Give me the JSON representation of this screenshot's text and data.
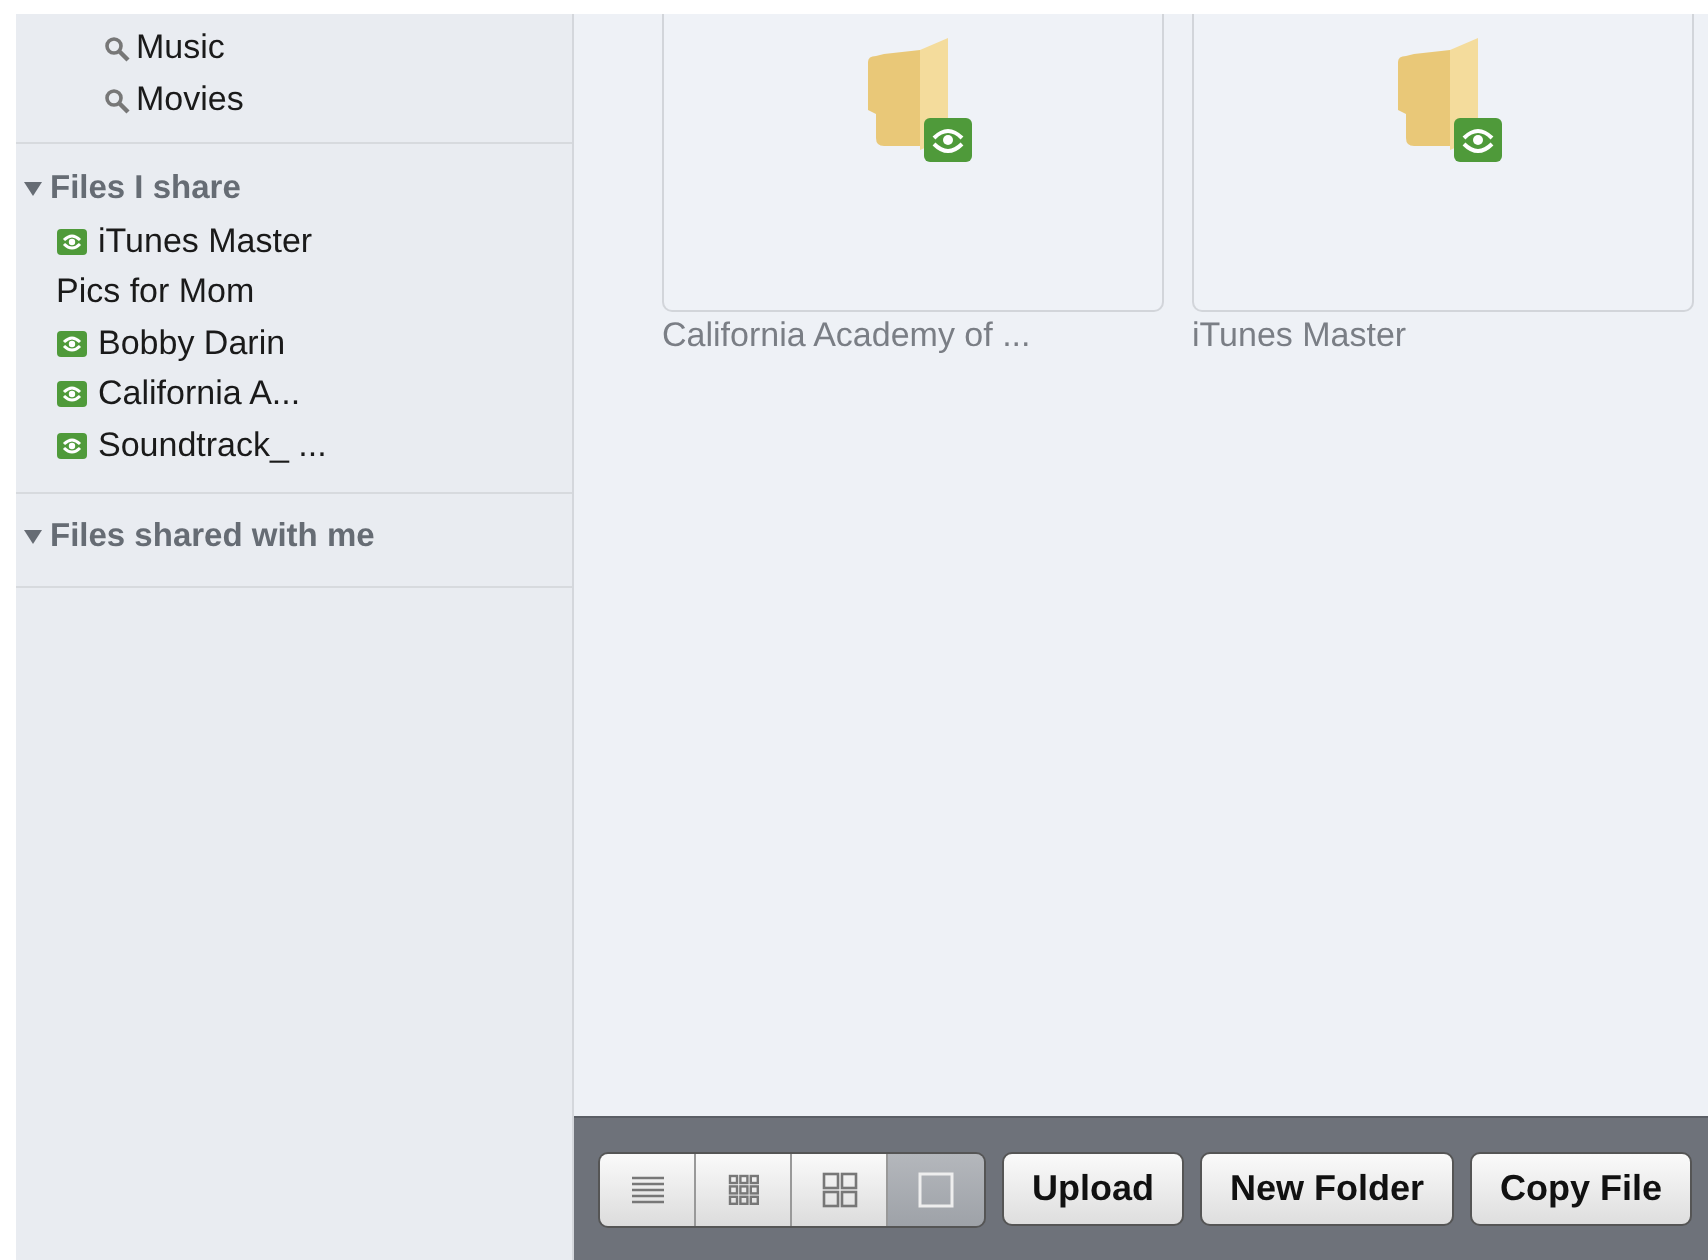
{
  "sidebar": {
    "search_items": [
      {
        "label": "Music"
      },
      {
        "label": "Movies"
      }
    ],
    "sections": [
      {
        "title": "Files I share",
        "expanded": true,
        "items": [
          {
            "label": "iTunes Master",
            "shared": true
          },
          {
            "label": "Pics for Mom",
            "shared": false
          },
          {
            "label": "Bobby Darin",
            "shared": true
          },
          {
            "label": "California A...",
            "shared": true
          },
          {
            "label": "Soundtrack_ ...",
            "shared": true
          }
        ]
      },
      {
        "title": "Files shared with me",
        "expanded": true
      }
    ]
  },
  "folders": [
    {
      "name": "California Academy of ...",
      "shared": true
    },
    {
      "name": "iTunes Master",
      "shared": true
    }
  ],
  "toolbar": {
    "views": [
      {
        "kind": "list",
        "selected": false
      },
      {
        "kind": "small-grid",
        "selected": false
      },
      {
        "kind": "large-grid",
        "selected": false
      },
      {
        "kind": "single",
        "selected": true
      }
    ],
    "buttons": [
      "Upload",
      "New Folder",
      "Copy File"
    ]
  }
}
